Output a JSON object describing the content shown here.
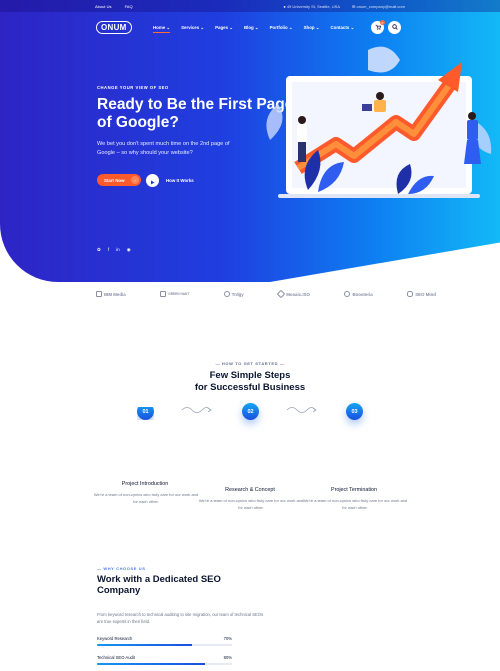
{
  "topbar": {
    "links": [
      "About Us",
      "FAQ"
    ],
    "address": "49 University St, Seattle, USA",
    "email": "onum_company@mail.com"
  },
  "nav": {
    "logo": "ONUM",
    "menu": [
      "Home",
      "Services",
      "Pages",
      "Blog",
      "Portfolio",
      "Shop",
      "Contacts"
    ],
    "active_index": 0,
    "cart_count": "0",
    "icons": [
      "cart-icon",
      "search-icon"
    ]
  },
  "hero": {
    "eyebrow": "CHANGE YOUR VIEW OF SEO",
    "title": "Ready to Be the First Page of Google?",
    "subtitle": "We bet you don't spent much time on the 2nd page of Google – so why should your website?",
    "start_label": "Start Now",
    "how_label": "How It Works",
    "socials": [
      "twitter-icon",
      "facebook-icon",
      "linkedin-icon",
      "instagram-icon"
    ],
    "accent": "#ff5a2c"
  },
  "brands": [
    "IBM Media",
    "GREEN HANT",
    "Trdgy",
    "Mosaic.ISO",
    "Boosteria",
    "SEO Mind"
  ],
  "steps": {
    "eyebrow": "HOW TO GET STARTED",
    "title_line1": "Few Simple Steps",
    "title_line2": "for Successful Business",
    "items": [
      {
        "num": "01",
        "title": "Project Introduction",
        "desc": "We're a team of non-cynics who truly care for our work and for each other."
      },
      {
        "num": "02",
        "title": "Research & Concept",
        "desc": "We're a team of non-cynics who truly care for our work and for each other."
      },
      {
        "num": "03",
        "title": "Project Termination",
        "desc": "We're a team of non-cynics who truly care for our work and for each other."
      }
    ]
  },
  "dedicated": {
    "eyebrow": "WHY CHOOSE US",
    "title": "Work with a Dedicated SEO Company",
    "ghost": "Work with a Dedicated",
    "desc": "From keyword research to technical auditing to site migration, our team of technical SEOs are true experts in their field.",
    "skills": [
      {
        "label": "Keyword Research",
        "value": "70%",
        "fraction": 0.7
      },
      {
        "label": "Technical SEO Audit",
        "value": "80%",
        "fraction": 0.8
      }
    ]
  }
}
